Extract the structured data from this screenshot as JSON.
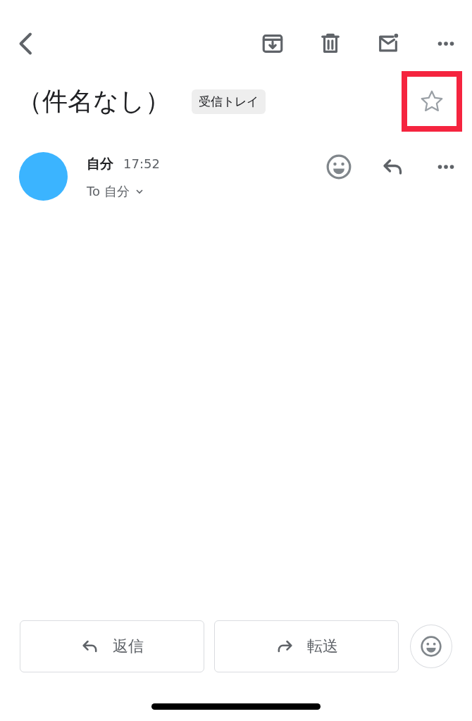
{
  "toolbar": {
    "actions": [
      {
        "kind": "archive"
      },
      {
        "kind": "delete"
      },
      {
        "kind": "unread"
      },
      {
        "kind": "more"
      }
    ]
  },
  "subject": {
    "title": "（件名なし）",
    "label": "受信トレイ",
    "starred": false,
    "highlighted": true
  },
  "message": {
    "sender": "自分",
    "time": "17:52",
    "recipient": "To 自分"
  },
  "footer": {
    "buttons": [
      {
        "kind": "reply",
        "label": "返信"
      },
      {
        "kind": "forward",
        "label": "転送"
      }
    ]
  }
}
